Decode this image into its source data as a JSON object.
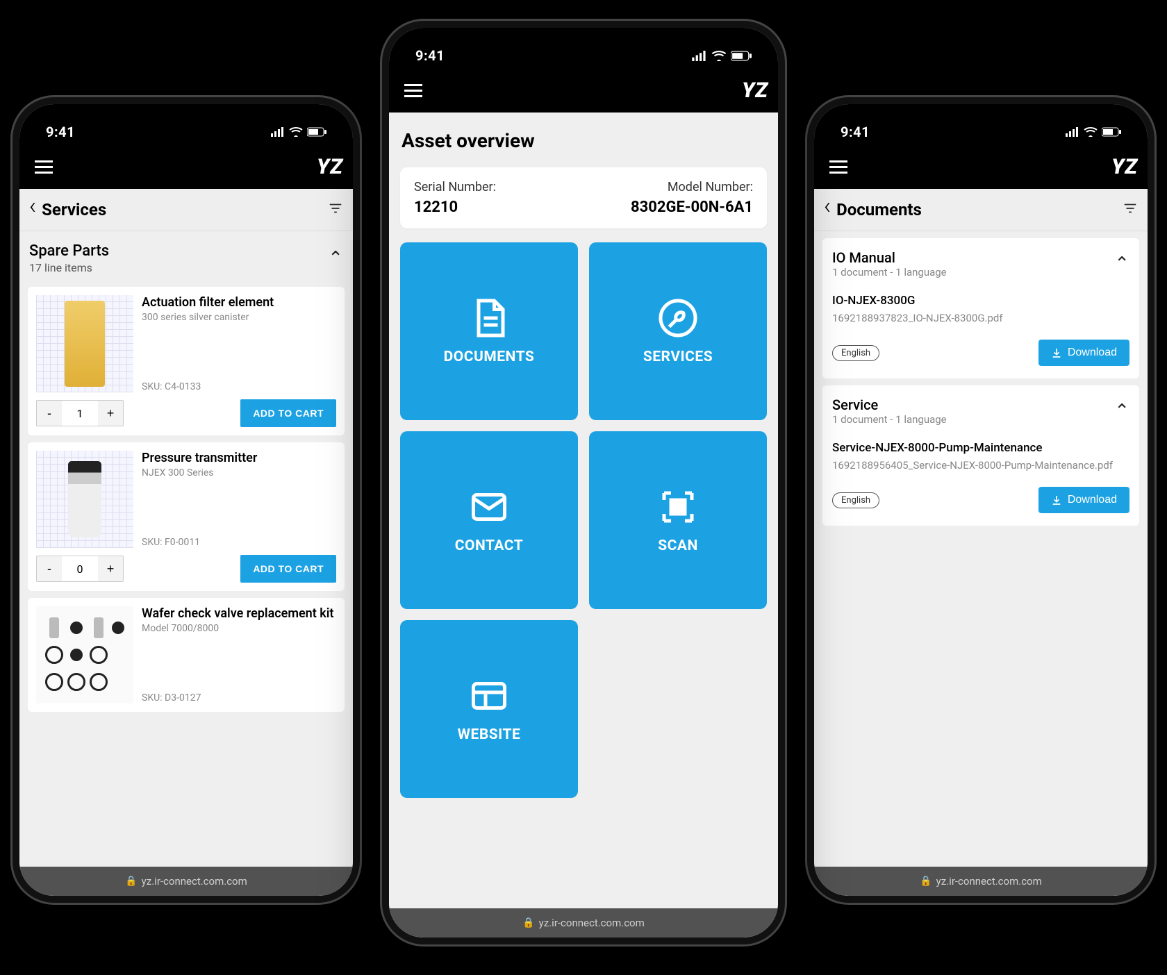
{
  "status": {
    "time": "9:41"
  },
  "brand": "YZ",
  "url": "yz.ir-connect.com.com",
  "left": {
    "page_title": "Services",
    "section_title": "Spare Parts",
    "section_sub": "17 line items",
    "add_to_cart_label": "ADD TO CART",
    "parts": [
      {
        "name": "Actuation filter element",
        "desc": "300 series silver canister",
        "sku": "SKU: C4-0133",
        "qty": "1"
      },
      {
        "name": "Pressure transmitter",
        "desc": "NJEX 300 Series",
        "sku": "SKU: F0-0011",
        "qty": "0"
      },
      {
        "name": "Wafer check valve replacement kit",
        "desc": "Model 7000/8000",
        "sku": "SKU: D3-0127"
      }
    ]
  },
  "center": {
    "page_title": "Asset overview",
    "serial_label": "Serial Number:",
    "serial_value": "12210",
    "model_label": "Model Number:",
    "model_value": "8302GE-00N-6A1",
    "tiles": {
      "documents": "DOCUMENTS",
      "services": "SERVICES",
      "contact": "CONTACT",
      "scan": "SCAN",
      "website": "WEBSITE"
    }
  },
  "right": {
    "page_title": "Documents",
    "download_label": "Download",
    "sections": [
      {
        "title": "IO Manual",
        "sub": "1 document - 1 language",
        "fname": "IO-NJEX-8300G",
        "ffile": "1692188937823_IO-NJEX-8300G.pdf",
        "lang": "English"
      },
      {
        "title": "Service",
        "sub": "1 document - 1 language",
        "fname": "Service-NJEX-8000-Pump-Maintenance",
        "ffile": "1692188956405_Service-NJEX-8000-Pump-Maintenance.pdf",
        "lang": "English"
      }
    ]
  }
}
